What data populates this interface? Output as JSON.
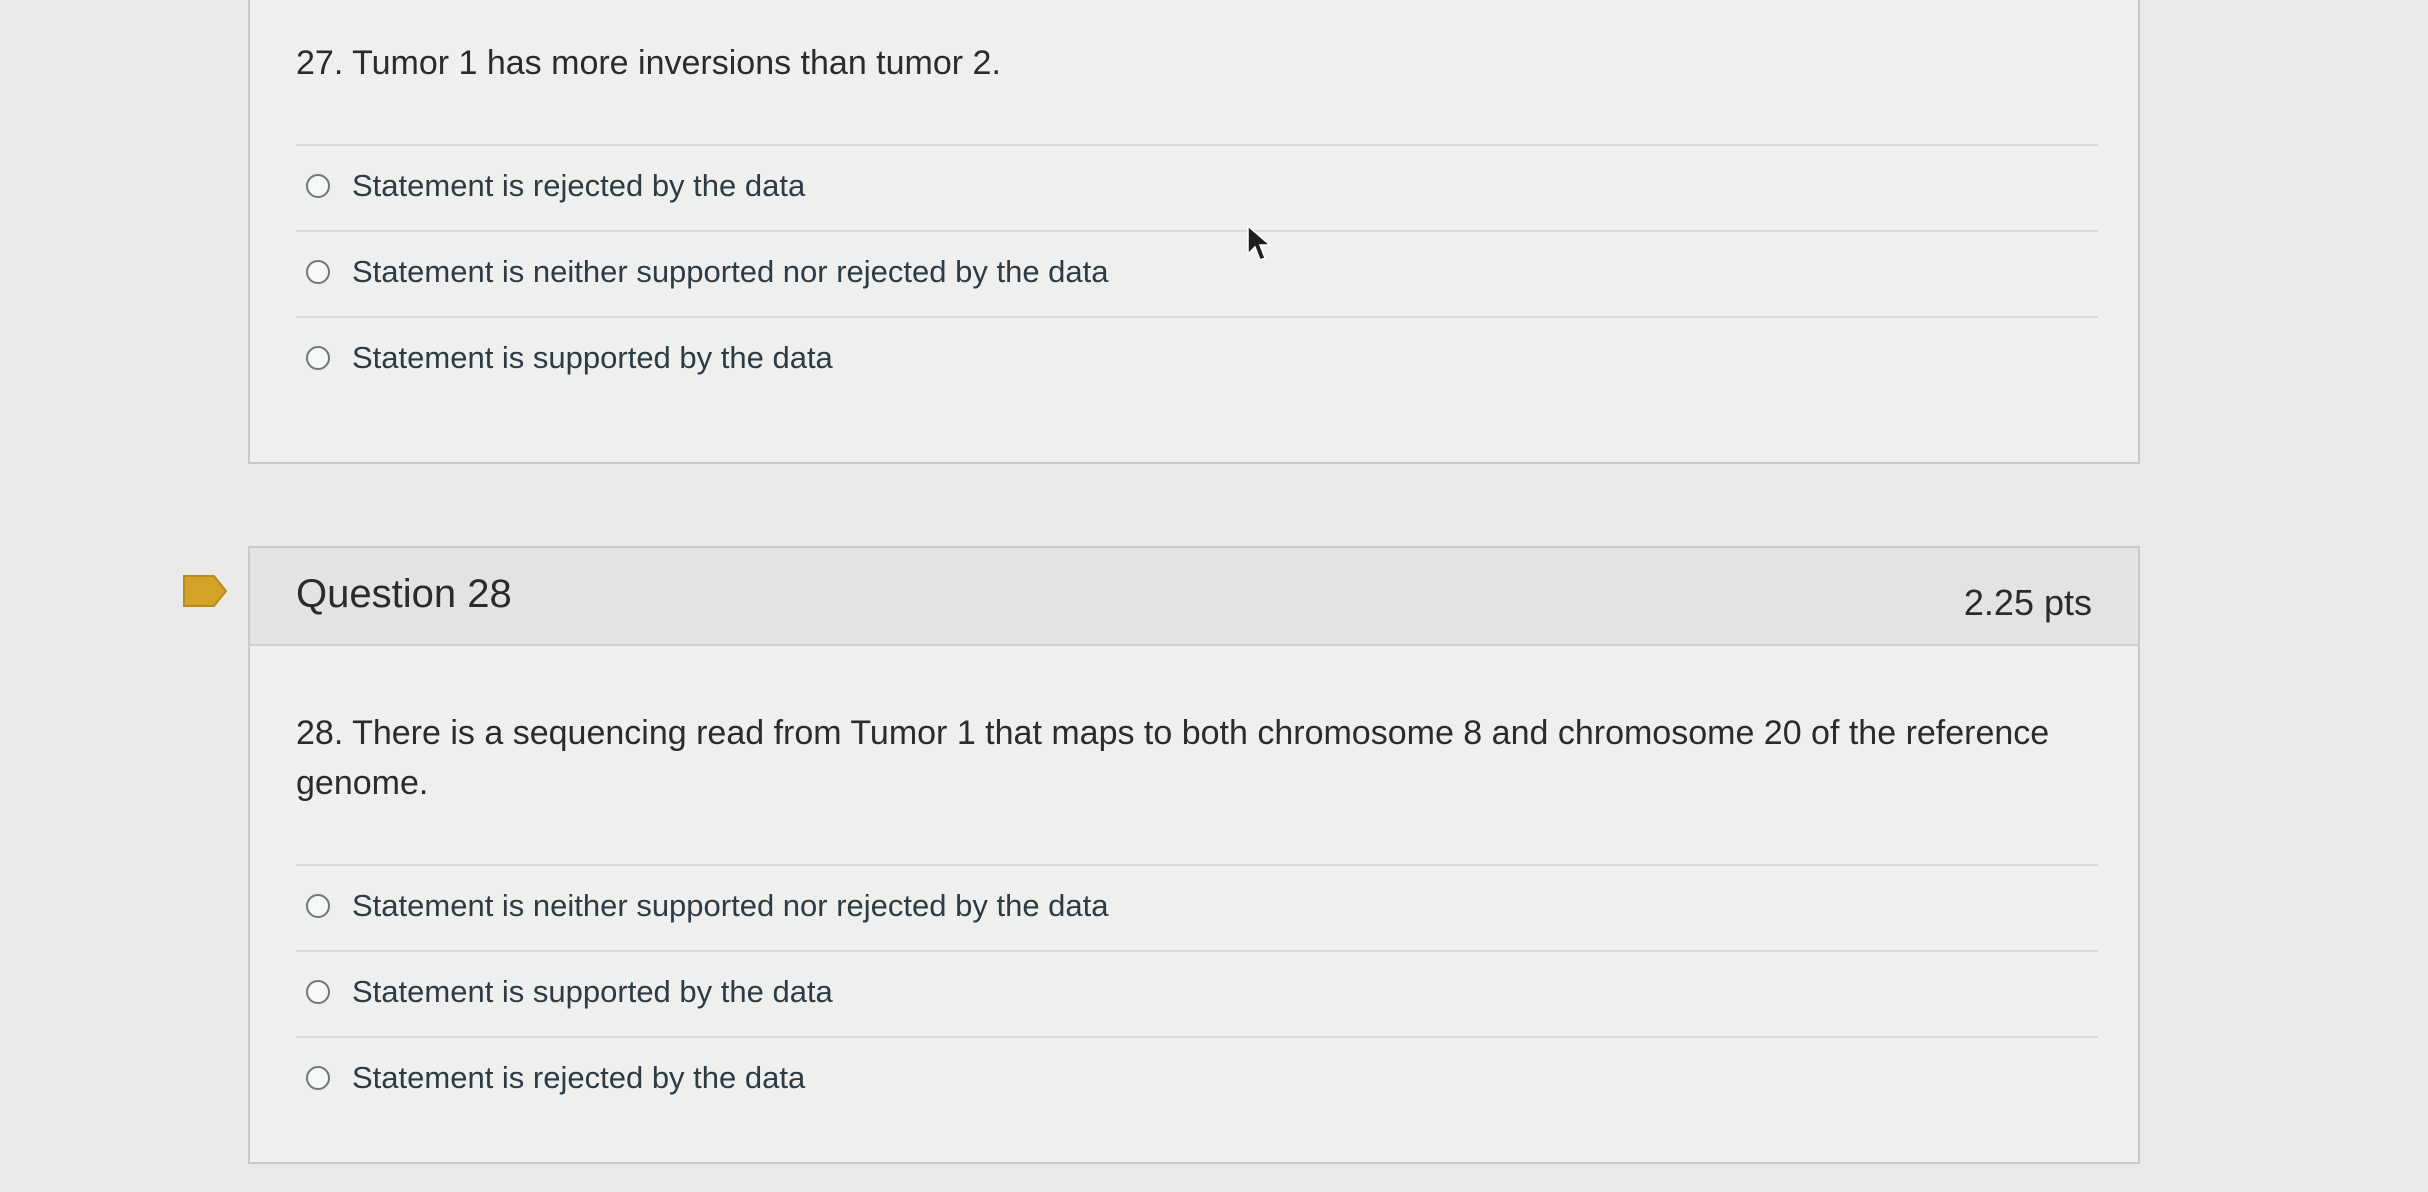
{
  "question27": {
    "text": "27. Tumor 1 has more inversions than tumor 2.",
    "answers": [
      {
        "label": "Statement is rejected by the data",
        "selected": false
      },
      {
        "label": "Statement is neither supported nor rejected by the data",
        "selected": false
      },
      {
        "label": "Statement is supported by the data",
        "selected": false
      }
    ]
  },
  "question28": {
    "title": "Question 28",
    "points": "2.25 pts",
    "text": "28. There is a sequencing read from Tumor 1 that maps to both chromosome 8 and chromosome 20 of the reference genome.",
    "answers": [
      {
        "label": "Statement is neither supported nor rejected by the data",
        "selected": false
      },
      {
        "label": "Statement is supported by the data",
        "selected": false
      },
      {
        "label": "Statement is rejected by the data",
        "selected": false
      }
    ]
  },
  "icons": {
    "flag": "bookmark-flag-icon",
    "cursor": "mouse-pointer-icon"
  },
  "colors": {
    "flag": "#d4a227",
    "background": "#e9e9e7",
    "card": "#efefed",
    "header": "#e3e3e1"
  }
}
